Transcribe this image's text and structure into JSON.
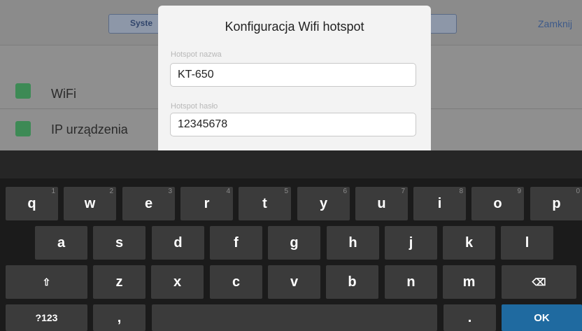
{
  "background": {
    "segment_label": "Syste",
    "close_label": "Zamknij",
    "rows": [
      {
        "label": "WiFi"
      },
      {
        "label": "IP urządzenia"
      }
    ]
  },
  "dialog": {
    "title": "Konfiguracja Wifi hotspot",
    "name_label": "Hotspot nazwa",
    "name_value": "KT-650",
    "password_label": "Hotspot hasło",
    "password_value": "12345678"
  },
  "keyboard": {
    "row1": [
      {
        "key": "q",
        "hint": "1"
      },
      {
        "key": "w",
        "hint": "2"
      },
      {
        "key": "e",
        "hint": "3"
      },
      {
        "key": "r",
        "hint": "4"
      },
      {
        "key": "t",
        "hint": "5"
      },
      {
        "key": "y",
        "hint": "6"
      },
      {
        "key": "u",
        "hint": "7"
      },
      {
        "key": "i",
        "hint": "8"
      },
      {
        "key": "o",
        "hint": "9"
      },
      {
        "key": "p",
        "hint": "0"
      }
    ],
    "row2": [
      "a",
      "s",
      "d",
      "f",
      "g",
      "h",
      "j",
      "k",
      "l"
    ],
    "row3": [
      "z",
      "x",
      "c",
      "v",
      "b",
      "n",
      "m"
    ],
    "symbols_label": "?123",
    "comma_label": ",",
    "period_label": ".",
    "ok_label": "OK",
    "shift_icon": "⇧",
    "backspace_icon": "⌫"
  },
  "colors": {
    "ok_key": "#1f6aa0",
    "key": "#3b3b3b",
    "dialog_bg": "#f3f3f3"
  }
}
